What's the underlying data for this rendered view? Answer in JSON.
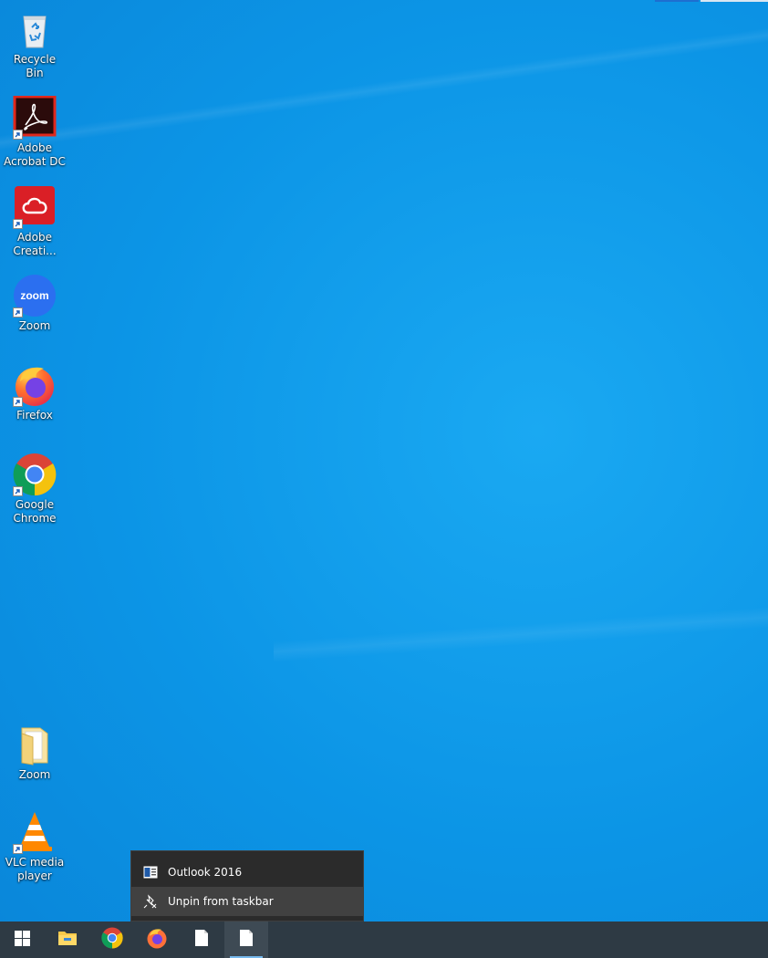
{
  "desktop": {
    "icons": [
      {
        "label": "Recycle Bin",
        "icon": "recycle-bin-icon"
      },
      {
        "label": "Adobe Acrobat DC",
        "icon": "adobe-acrobat-icon"
      },
      {
        "label": "Adobe Creati...",
        "icon": "adobe-creative-cloud-icon"
      },
      {
        "label": "Zoom",
        "icon": "zoom-icon"
      },
      {
        "label": "Firefox",
        "icon": "firefox-icon"
      },
      {
        "label": "Google Chrome",
        "icon": "chrome-icon"
      },
      {
        "label": "Zoom",
        "icon": "folder-icon"
      },
      {
        "label": "VLC media player",
        "icon": "vlc-icon"
      }
    ]
  },
  "jumplist": {
    "items": [
      {
        "label": "Outlook 2016",
        "icon": "outlook-icon"
      },
      {
        "label": "Unpin from taskbar",
        "icon": "unpin-icon"
      }
    ]
  },
  "taskbar": {
    "buttons": [
      {
        "icon": "windows-start-icon"
      },
      {
        "icon": "file-explorer-icon"
      },
      {
        "icon": "chrome-icon"
      },
      {
        "icon": "firefox-icon"
      },
      {
        "icon": "blank-document-icon"
      },
      {
        "icon": "blank-document-icon"
      }
    ]
  },
  "colors": {
    "desktop_blue": "#0c95e6",
    "taskbar": "#2e3a44",
    "menu_bg": "#2b2b2b",
    "menu_hover": "#414141"
  }
}
